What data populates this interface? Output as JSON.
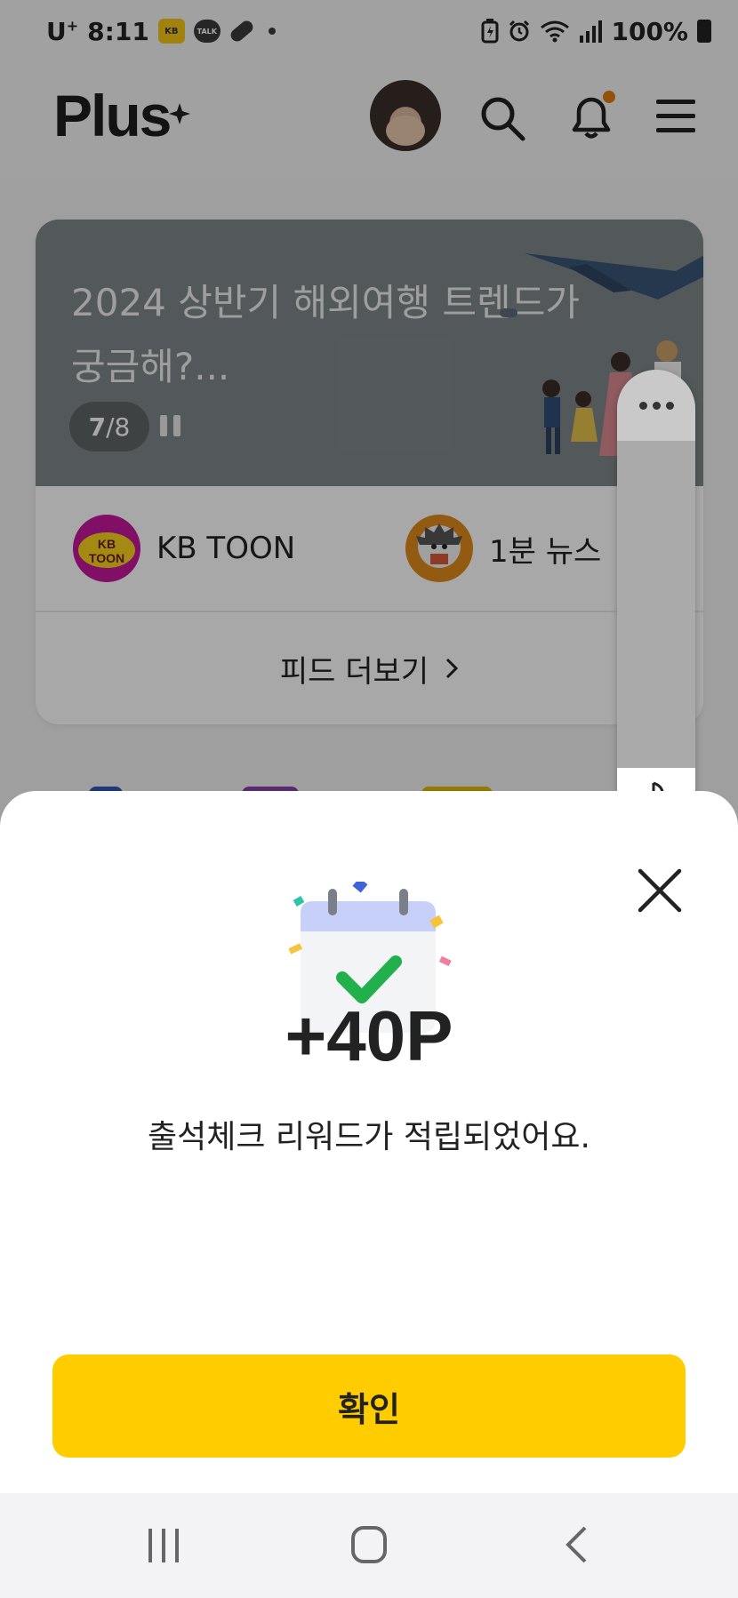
{
  "status_bar": {
    "carrier": "U",
    "carrier_sup": "+",
    "time": "8:11",
    "battery": "100%"
  },
  "header": {
    "logo": "Plus",
    "icons": [
      "profile-avatar",
      "search-icon",
      "notification-bell-icon",
      "menu-icon"
    ],
    "notification_dot_color": "#e07b10"
  },
  "banner": {
    "title": "2024 상반기 해외여행 트렌드가 궁금해?...",
    "page_current": "7",
    "page_total": "/8"
  },
  "shortcuts": [
    {
      "label": "KB TOON",
      "icon": "kb-toon-logo"
    },
    {
      "label": "1분 뉴스",
      "icon": "hedgehog-news-icon"
    }
  ],
  "feed_more": {
    "label": "피드 더보기"
  },
  "reward_sheet": {
    "points": "+40P",
    "message": "출석체크 리워드가 적립되었어요.",
    "confirm_label": "확인"
  },
  "colors": {
    "accent": "#ffcc00",
    "check": "#22c55e"
  }
}
